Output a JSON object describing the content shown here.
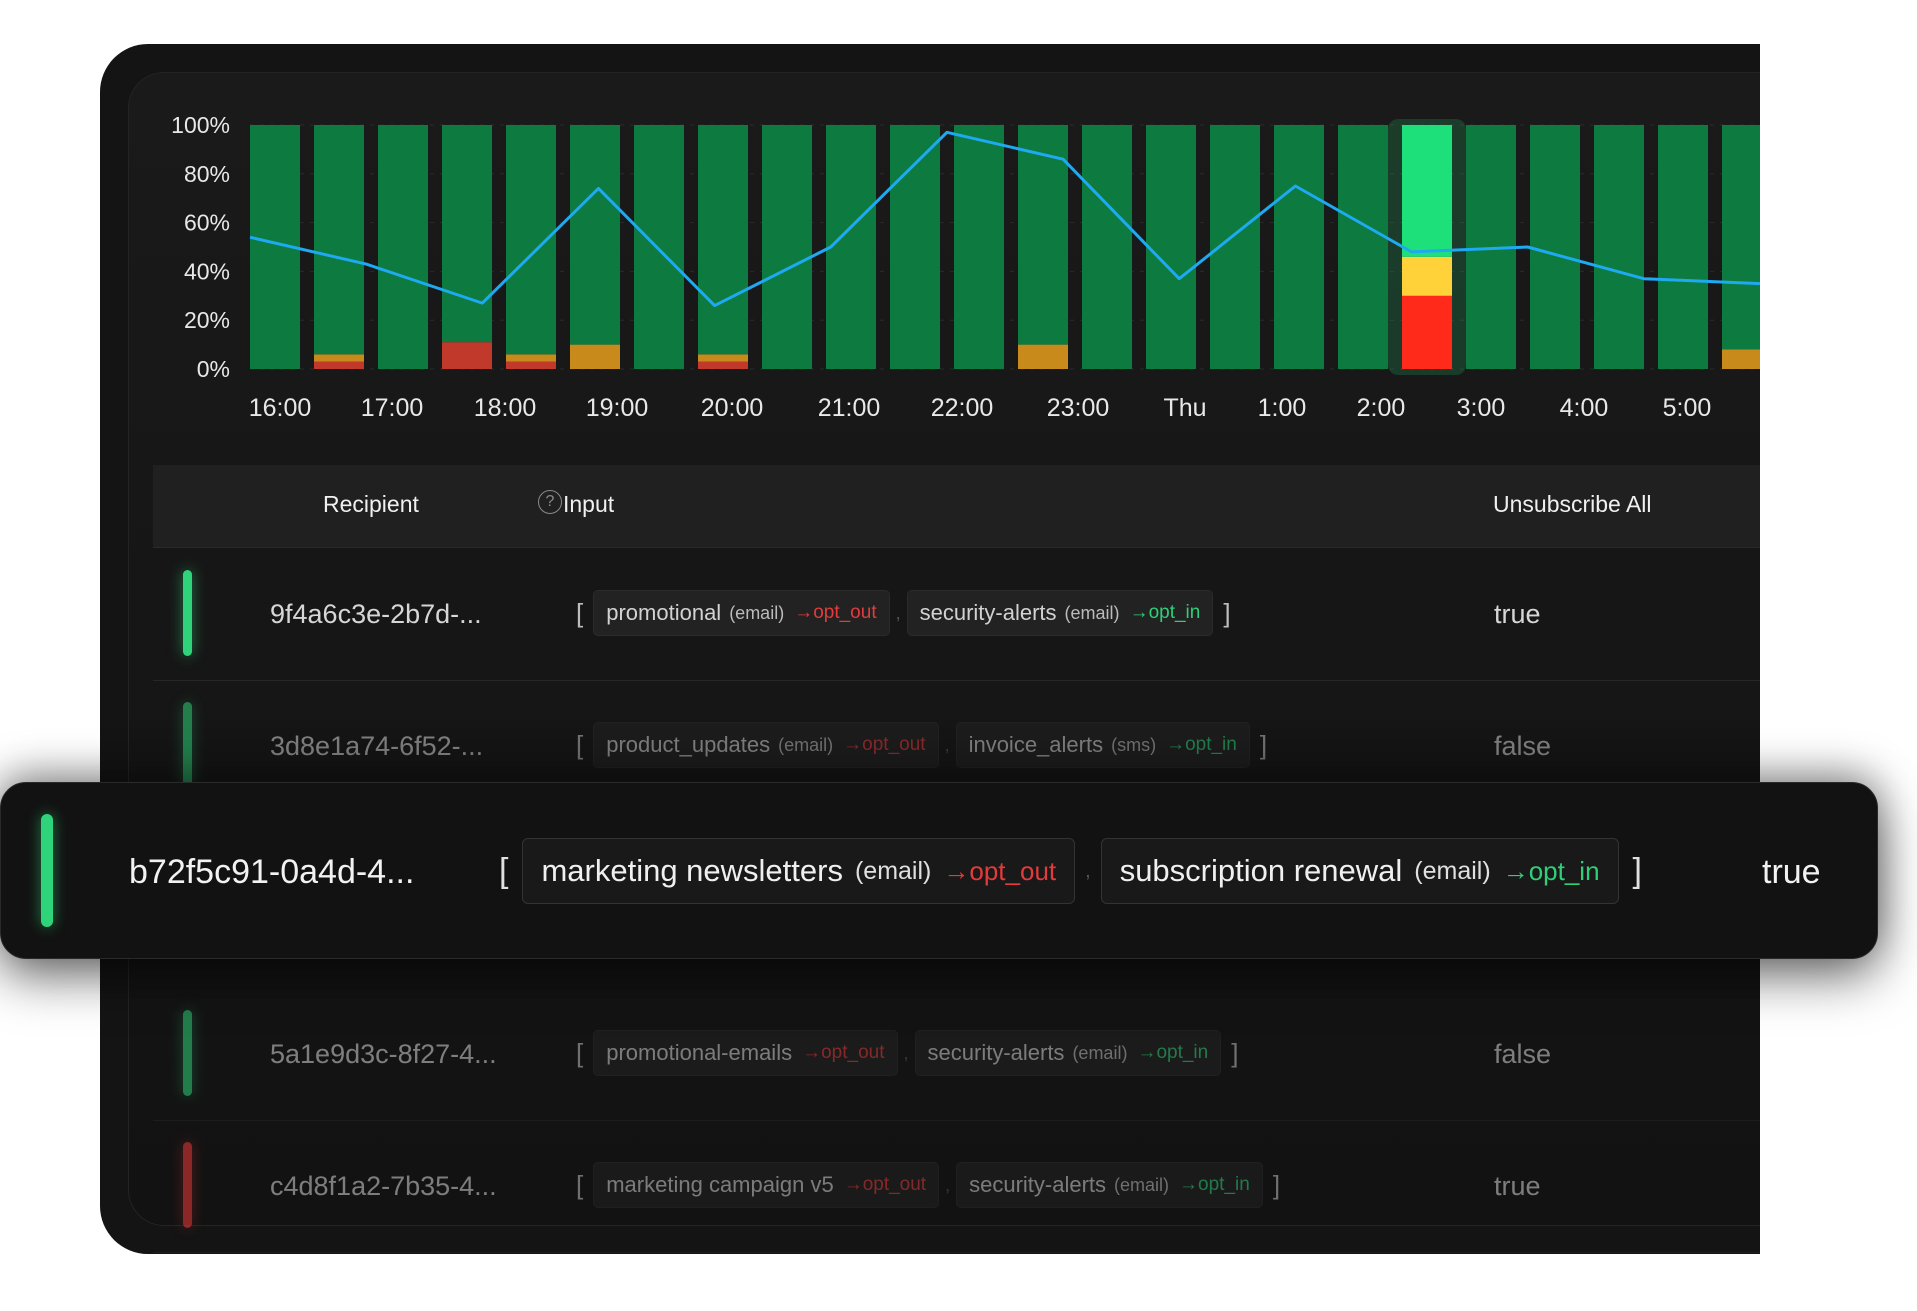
{
  "chart_data": {
    "type": "bar",
    "yticks": [
      "100%",
      "80%",
      "60%",
      "40%",
      "20%",
      "0%"
    ],
    "ylim": [
      0,
      100
    ],
    "xticks": [
      "16:00",
      "17:00",
      "18:00",
      "19:00",
      "20:00",
      "21:00",
      "22:00",
      "23:00",
      "Thu",
      "1:00",
      "2:00",
      "3:00",
      "4:00",
      "5:00"
    ],
    "bars": [
      {
        "green": 100,
        "yellow": 0,
        "red": 0
      },
      {
        "green": 94,
        "yellow": 3,
        "red": 3
      },
      {
        "green": 100,
        "yellow": 0,
        "red": 0
      },
      {
        "green": 89,
        "yellow": 0,
        "red": 11
      },
      {
        "green": 94,
        "yellow": 3,
        "red": 3
      },
      {
        "green": 90,
        "yellow": 10,
        "red": 0
      },
      {
        "green": 100,
        "yellow": 0,
        "red": 0
      },
      {
        "green": 94,
        "yellow": 3,
        "red": 3
      },
      {
        "green": 100,
        "yellow": 0,
        "red": 0
      },
      {
        "green": 100,
        "yellow": 0,
        "red": 0
      },
      {
        "green": 100,
        "yellow": 0,
        "red": 0
      },
      {
        "green": 100,
        "yellow": 0,
        "red": 0
      },
      {
        "green": 90,
        "yellow": 10,
        "red": 0
      },
      {
        "green": 100,
        "yellow": 0,
        "red": 0
      },
      {
        "green": 100,
        "yellow": 0,
        "red": 0
      },
      {
        "green": 100,
        "yellow": 0,
        "red": 0
      },
      {
        "green": 100,
        "yellow": 0,
        "red": 0
      },
      {
        "green": 100,
        "yellow": 0,
        "red": 0
      },
      {
        "green": 54,
        "yellow": 16,
        "red": 30,
        "highlight": true
      },
      {
        "green": 100,
        "yellow": 0,
        "red": 0
      },
      {
        "green": 100,
        "yellow": 0,
        "red": 0
      },
      {
        "green": 100,
        "yellow": 0,
        "red": 0
      },
      {
        "green": 100,
        "yellow": 0,
        "red": 0
      },
      {
        "green": 92,
        "yellow": 8,
        "red": 0
      }
    ],
    "line": [
      54,
      43,
      27,
      74,
      26,
      50,
      97,
      86,
      37,
      75,
      48,
      50,
      37,
      35
    ],
    "colors": {
      "green": "#0d7a40",
      "green_highlight": "#1ee07a",
      "yellow": "#c98a1c",
      "yellow_highlight": "#ffd23a",
      "red": "#c0392b",
      "red_highlight": "#ff2a1a",
      "line": "#1ea9f0"
    }
  },
  "table": {
    "headers": {
      "recipient": "Recipient",
      "input": "Input",
      "unsubscribe": "Unsubscribe All"
    },
    "help_icon": "?",
    "rows": [
      {
        "id": "9f4a6c3e-2b7d-...",
        "status": "green",
        "open": "[",
        "close": "]",
        "chips": [
          {
            "name": "promotional",
            "channel": "(email)",
            "action": "→opt_out",
            "kind": "out"
          },
          {
            "name": "security-alerts",
            "channel": "(email)",
            "action": "→opt_in",
            "kind": "in"
          }
        ],
        "value": "true"
      },
      {
        "id": "3d8e1a74-6f52-...",
        "status": "green",
        "open": "[",
        "close": "]",
        "chips": [
          {
            "name": "product_updates",
            "channel": "(email)",
            "action": "→opt_out",
            "kind": "out"
          },
          {
            "name": "invoice_alerts",
            "channel": "(sms)",
            "action": "→opt_in",
            "kind": "in"
          }
        ],
        "value": "false"
      },
      {
        "id": "5a1e9d3c-8f27-4...",
        "status": "green",
        "open": "[",
        "close": "]",
        "chips": [
          {
            "name": "promotional-emails",
            "channel": "",
            "action": "→opt_out",
            "kind": "out"
          },
          {
            "name": "security-alerts",
            "channel": "(email)",
            "action": "→opt_in",
            "kind": "in"
          }
        ],
        "value": "false"
      },
      {
        "id": "c4d8f1a2-7b35-4...",
        "status": "red",
        "open": "[",
        "close": "]",
        "chips": [
          {
            "name": "marketing campaign v5",
            "channel": "",
            "action": "→opt_out",
            "kind": "out"
          },
          {
            "name": "security-alerts",
            "channel": "(email)",
            "action": "→opt_in",
            "kind": "in"
          }
        ],
        "value": "true"
      }
    ]
  },
  "highlight_row": {
    "id": "b72f5c91-0a4d-4...",
    "status": "green",
    "open": "[",
    "close": "]",
    "chips": [
      {
        "name": "marketing newsletters",
        "channel": "(email)",
        "action": "→opt_out",
        "kind": "out"
      },
      {
        "name": "subscription renewal",
        "channel": "(email)",
        "action": "→opt_in",
        "kind": "in"
      }
    ],
    "value": "true"
  }
}
